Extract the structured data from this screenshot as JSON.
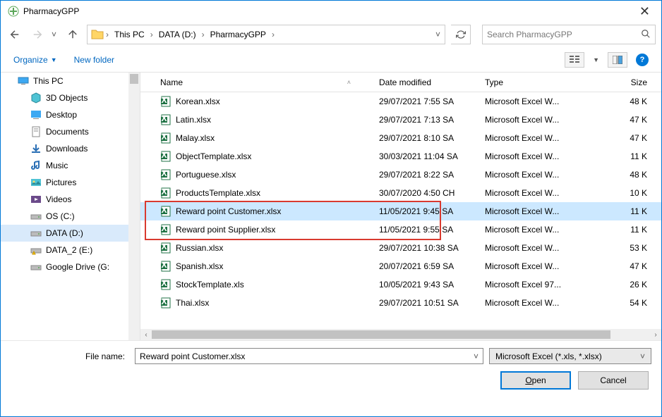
{
  "window": {
    "title": "PharmacyGPP"
  },
  "nav": {
    "crumbs": [
      "This PC",
      "DATA (D:)",
      "PharmacyGPP"
    ],
    "search_placeholder": "Search PharmacyGPP"
  },
  "toolbar": {
    "organize": "Organize",
    "newfolder": "New folder",
    "help": "?"
  },
  "tree": [
    {
      "label": "This PC",
      "indent": false,
      "icon": "pc"
    },
    {
      "label": "3D Objects",
      "indent": true,
      "icon": "3d"
    },
    {
      "label": "Desktop",
      "indent": true,
      "icon": "desktop"
    },
    {
      "label": "Documents",
      "indent": true,
      "icon": "docs"
    },
    {
      "label": "Downloads",
      "indent": true,
      "icon": "down"
    },
    {
      "label": "Music",
      "indent": true,
      "icon": "music"
    },
    {
      "label": "Pictures",
      "indent": true,
      "icon": "pics"
    },
    {
      "label": "Videos",
      "indent": true,
      "icon": "vids"
    },
    {
      "label": "OS (C:)",
      "indent": true,
      "icon": "drive"
    },
    {
      "label": "DATA (D:)",
      "indent": true,
      "icon": "drive",
      "selected": true
    },
    {
      "label": "DATA_2 (E:)",
      "indent": true,
      "icon": "drive-warn"
    },
    {
      "label": "Google Drive (G:",
      "indent": true,
      "icon": "drive"
    }
  ],
  "columns": {
    "name": "Name",
    "date": "Date modified",
    "type": "Type",
    "size": "Size"
  },
  "files": [
    {
      "name": "Korean.xlsx",
      "date": "29/07/2021 7:55 SA",
      "type": "Microsoft Excel W...",
      "size": "48 K"
    },
    {
      "name": "Latin.xlsx",
      "date": "29/07/2021 7:13 SA",
      "type": "Microsoft Excel W...",
      "size": "47 K"
    },
    {
      "name": "Malay.xlsx",
      "date": "29/07/2021 8:10 SA",
      "type": "Microsoft Excel W...",
      "size": "47 K"
    },
    {
      "name": "ObjectTemplate.xlsx",
      "date": "30/03/2021 11:04 SA",
      "type": "Microsoft Excel W...",
      "size": "11 K"
    },
    {
      "name": "Portuguese.xlsx",
      "date": "29/07/2021 8:22 SA",
      "type": "Microsoft Excel W...",
      "size": "48 K"
    },
    {
      "name": "ProductsTemplate.xlsx",
      "date": "30/07/2020 4:50 CH",
      "type": "Microsoft Excel W...",
      "size": "10 K"
    },
    {
      "name": "Reward point Customer.xlsx",
      "date": "11/05/2021 9:45 SA",
      "type": "Microsoft Excel W...",
      "size": "11 K",
      "selected": true,
      "highlight": true
    },
    {
      "name": "Reward point Supplier.xlsx",
      "date": "11/05/2021 9:55 SA",
      "type": "Microsoft Excel W...",
      "size": "11 K",
      "highlight": true
    },
    {
      "name": "Russian.xlsx",
      "date": "29/07/2021 10:38 SA",
      "type": "Microsoft Excel W...",
      "size": "53 K"
    },
    {
      "name": "Spanish.xlsx",
      "date": "20/07/2021 6:59 SA",
      "type": "Microsoft Excel W...",
      "size": "47 K"
    },
    {
      "name": "StockTemplate.xls",
      "date": "10/05/2021 9:43 SA",
      "type": "Microsoft Excel 97...",
      "size": "26 K"
    },
    {
      "name": "Thai.xlsx",
      "date": "29/07/2021 10:51 SA",
      "type": "Microsoft Excel W...",
      "size": "54 K"
    }
  ],
  "footer": {
    "filename_label": "File name:",
    "filename_value": "Reward point Customer.xlsx",
    "filter": "Microsoft Excel (*.xls, *.xlsx)",
    "open": "Open",
    "cancel": "Cancel"
  }
}
